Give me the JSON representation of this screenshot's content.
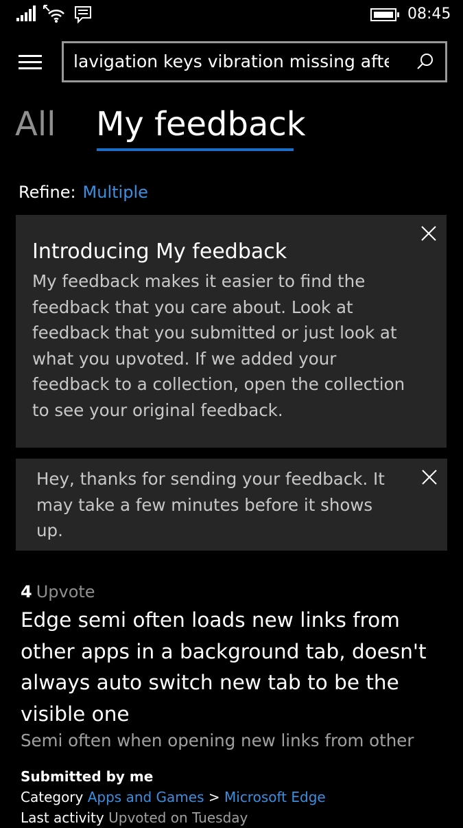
{
  "status_bar": {
    "time": "08:45"
  },
  "search": {
    "value": "lavigation keys vibration missing after"
  },
  "pivots": {
    "all_label": "All",
    "mine_label": "My feedback"
  },
  "refine": {
    "label": "Refine:",
    "value": "Multiple"
  },
  "intro_card": {
    "title": "Introducing My feedback",
    "body": "My feedback makes it easier to find the feedback that you care about. Look at feedback that you submitted or just look at what you upvoted. If we added your feedback to a collection, open the collection to see your original feedback."
  },
  "thanks_card": {
    "body": "Hey, thanks for sending your feedback. It may take a few minutes before it shows up."
  },
  "feedback_item": {
    "upvote_count": "4",
    "upvote_label": "Upvote",
    "title": "Edge semi often loads new links from other apps in a background tab, doesn't always auto switch new tab to be the visible one",
    "summary": "Semi often when opening new links from other",
    "submitted": "Submitted by me",
    "category_label": "Category",
    "category_primary": "Apps and Games",
    "category_separator": ">",
    "category_secondary": "Microsoft Edge",
    "activity_label": "Last activity",
    "activity_value": "Upvoted on Tuesday"
  },
  "colors": {
    "accent": "#1a6fc9",
    "link": "#3b8fe0",
    "card_background": "#262626",
    "background": "#000000"
  }
}
